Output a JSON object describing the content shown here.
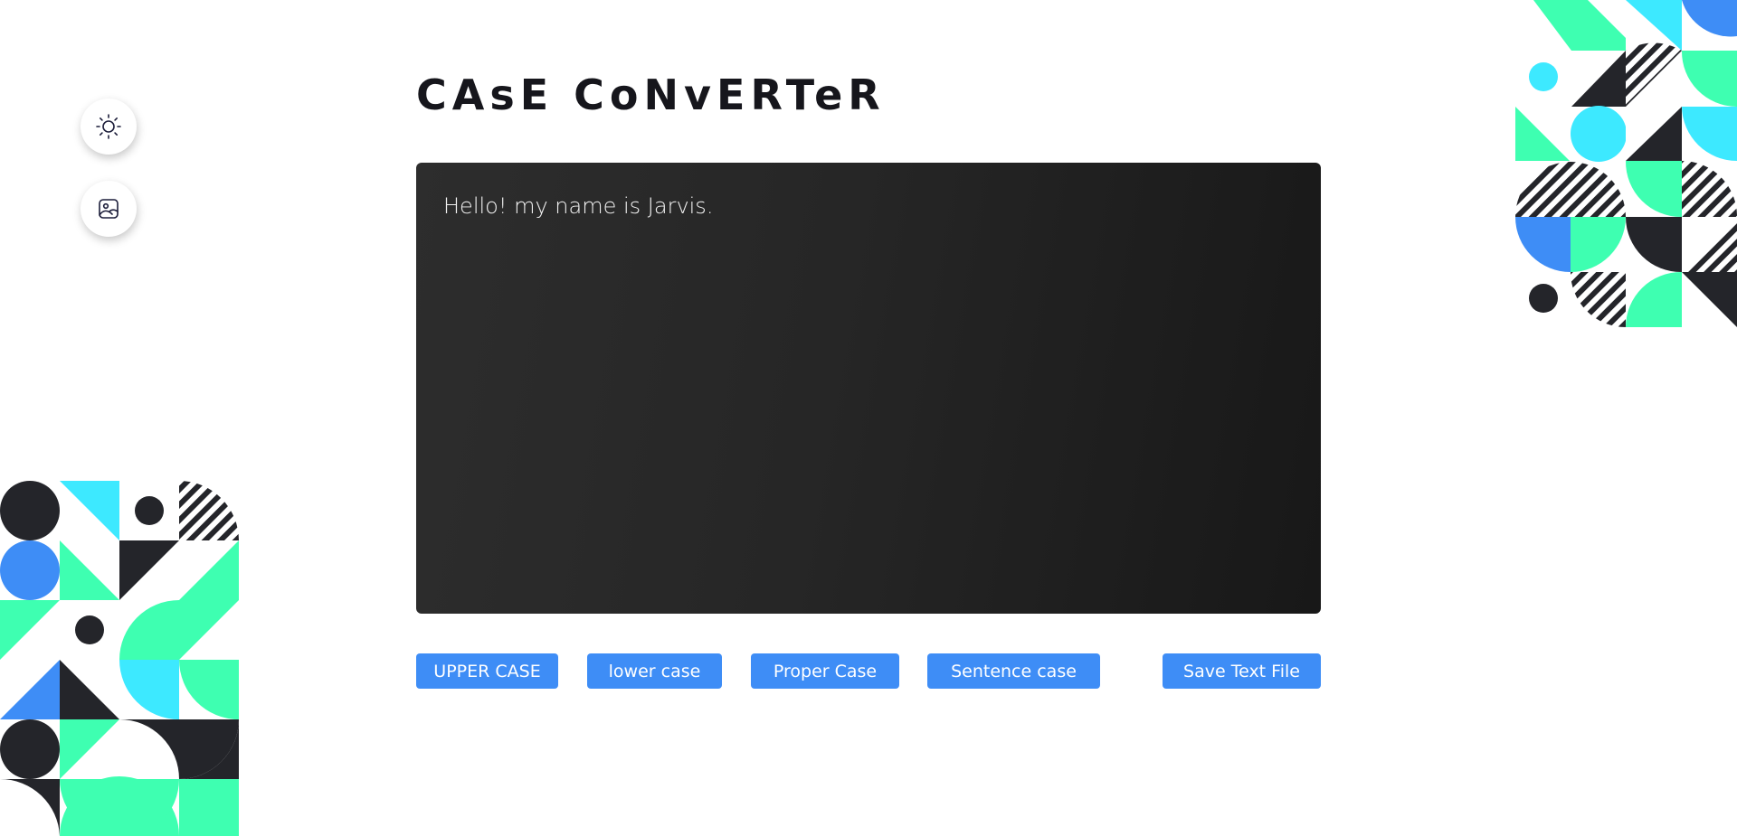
{
  "app": {
    "title": "CAsE CoNvERTeR"
  },
  "side_buttons": [
    {
      "icon": "sun-icon",
      "label": "Toggle theme"
    },
    {
      "icon": "image-icon",
      "label": "Change background"
    }
  ],
  "editor": {
    "value": "Hello! my name is Jarvis."
  },
  "actions": {
    "upper": "UPPER CASE",
    "lower": "lower case",
    "proper": "Proper Case",
    "sentence": "Sentence case",
    "save": "Save Text File"
  },
  "colors": {
    "accent": "#3e8df6",
    "mint": "#3effb1",
    "cyan": "#3de9ff",
    "blue": "#3e8df6",
    "dark": "#24252a",
    "editor_bg": "#262626"
  }
}
